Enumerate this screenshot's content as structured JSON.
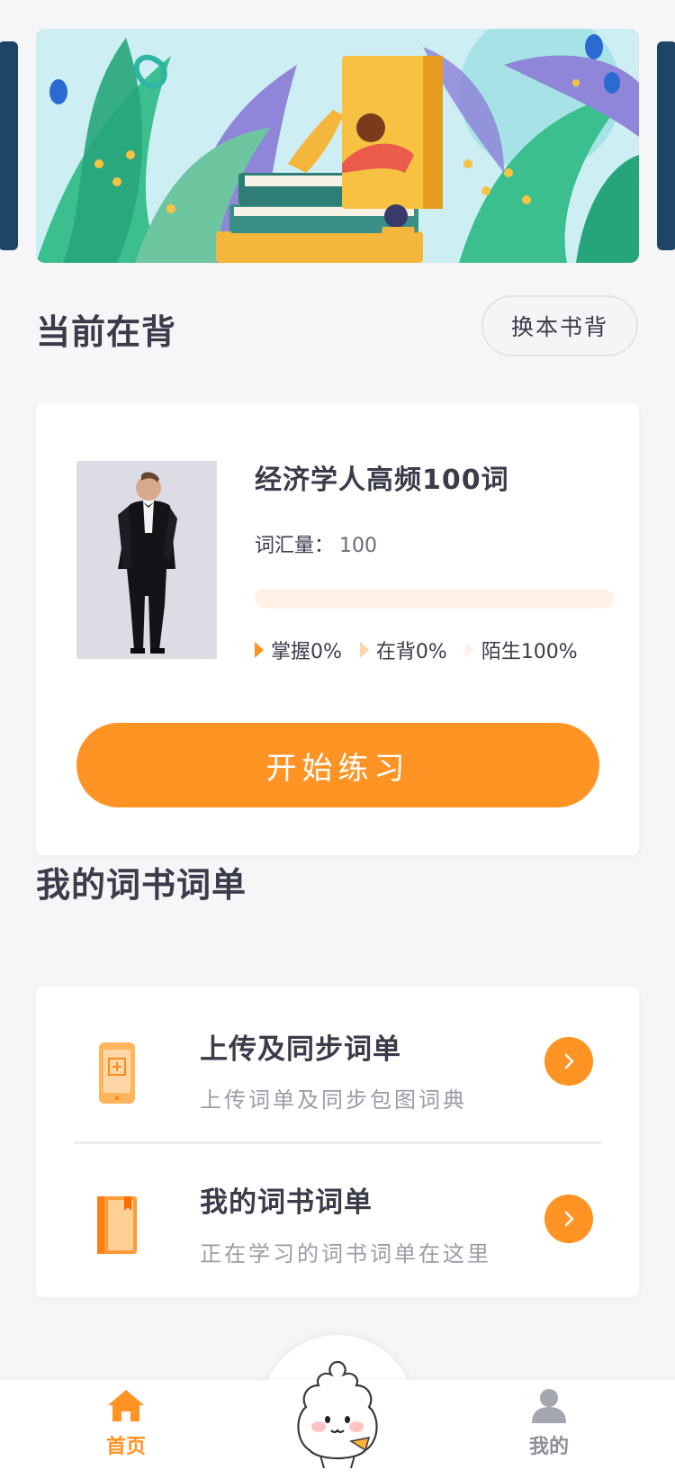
{
  "banner": {
    "illustration": "reading-books-illustration",
    "colors": {
      "sky": "#cdeef3",
      "leaf_green": "#3bbf8e",
      "leaf_purple": "#8f85d9",
      "book_yellow": "#f7c242",
      "peek_card": "#1f4566"
    }
  },
  "current": {
    "title": "当前在背",
    "switch_label": "换本书背"
  },
  "book": {
    "cover": "man-in-tuxedo-photo",
    "title": "经济学人高频100词",
    "vocab_label": "词汇量：",
    "vocab_count": "100",
    "progress_mastered": 0,
    "stats": {
      "mastered": "掌握0%",
      "learning": "在背0%",
      "unknown": "陌生100%"
    },
    "start_label": "开始练习"
  },
  "my_lists": {
    "title": "我的词书词单",
    "items": [
      {
        "icon": "phone-upload-icon",
        "title": "上传及同步词单",
        "subtitle": "上传词单及同步包图词典"
      },
      {
        "icon": "book-icon",
        "title": "我的词书词单",
        "subtitle": "正在学习的词书词单在这里"
      }
    ]
  },
  "nav": {
    "home_label": "首页",
    "mine_label": "我的",
    "center_icon": "bun-mascot-icon"
  },
  "colors": {
    "accent": "#ff9425",
    "text": "#3a3c4a",
    "subtext": "#9a9ca6",
    "progress_track": "#fff1e6"
  }
}
